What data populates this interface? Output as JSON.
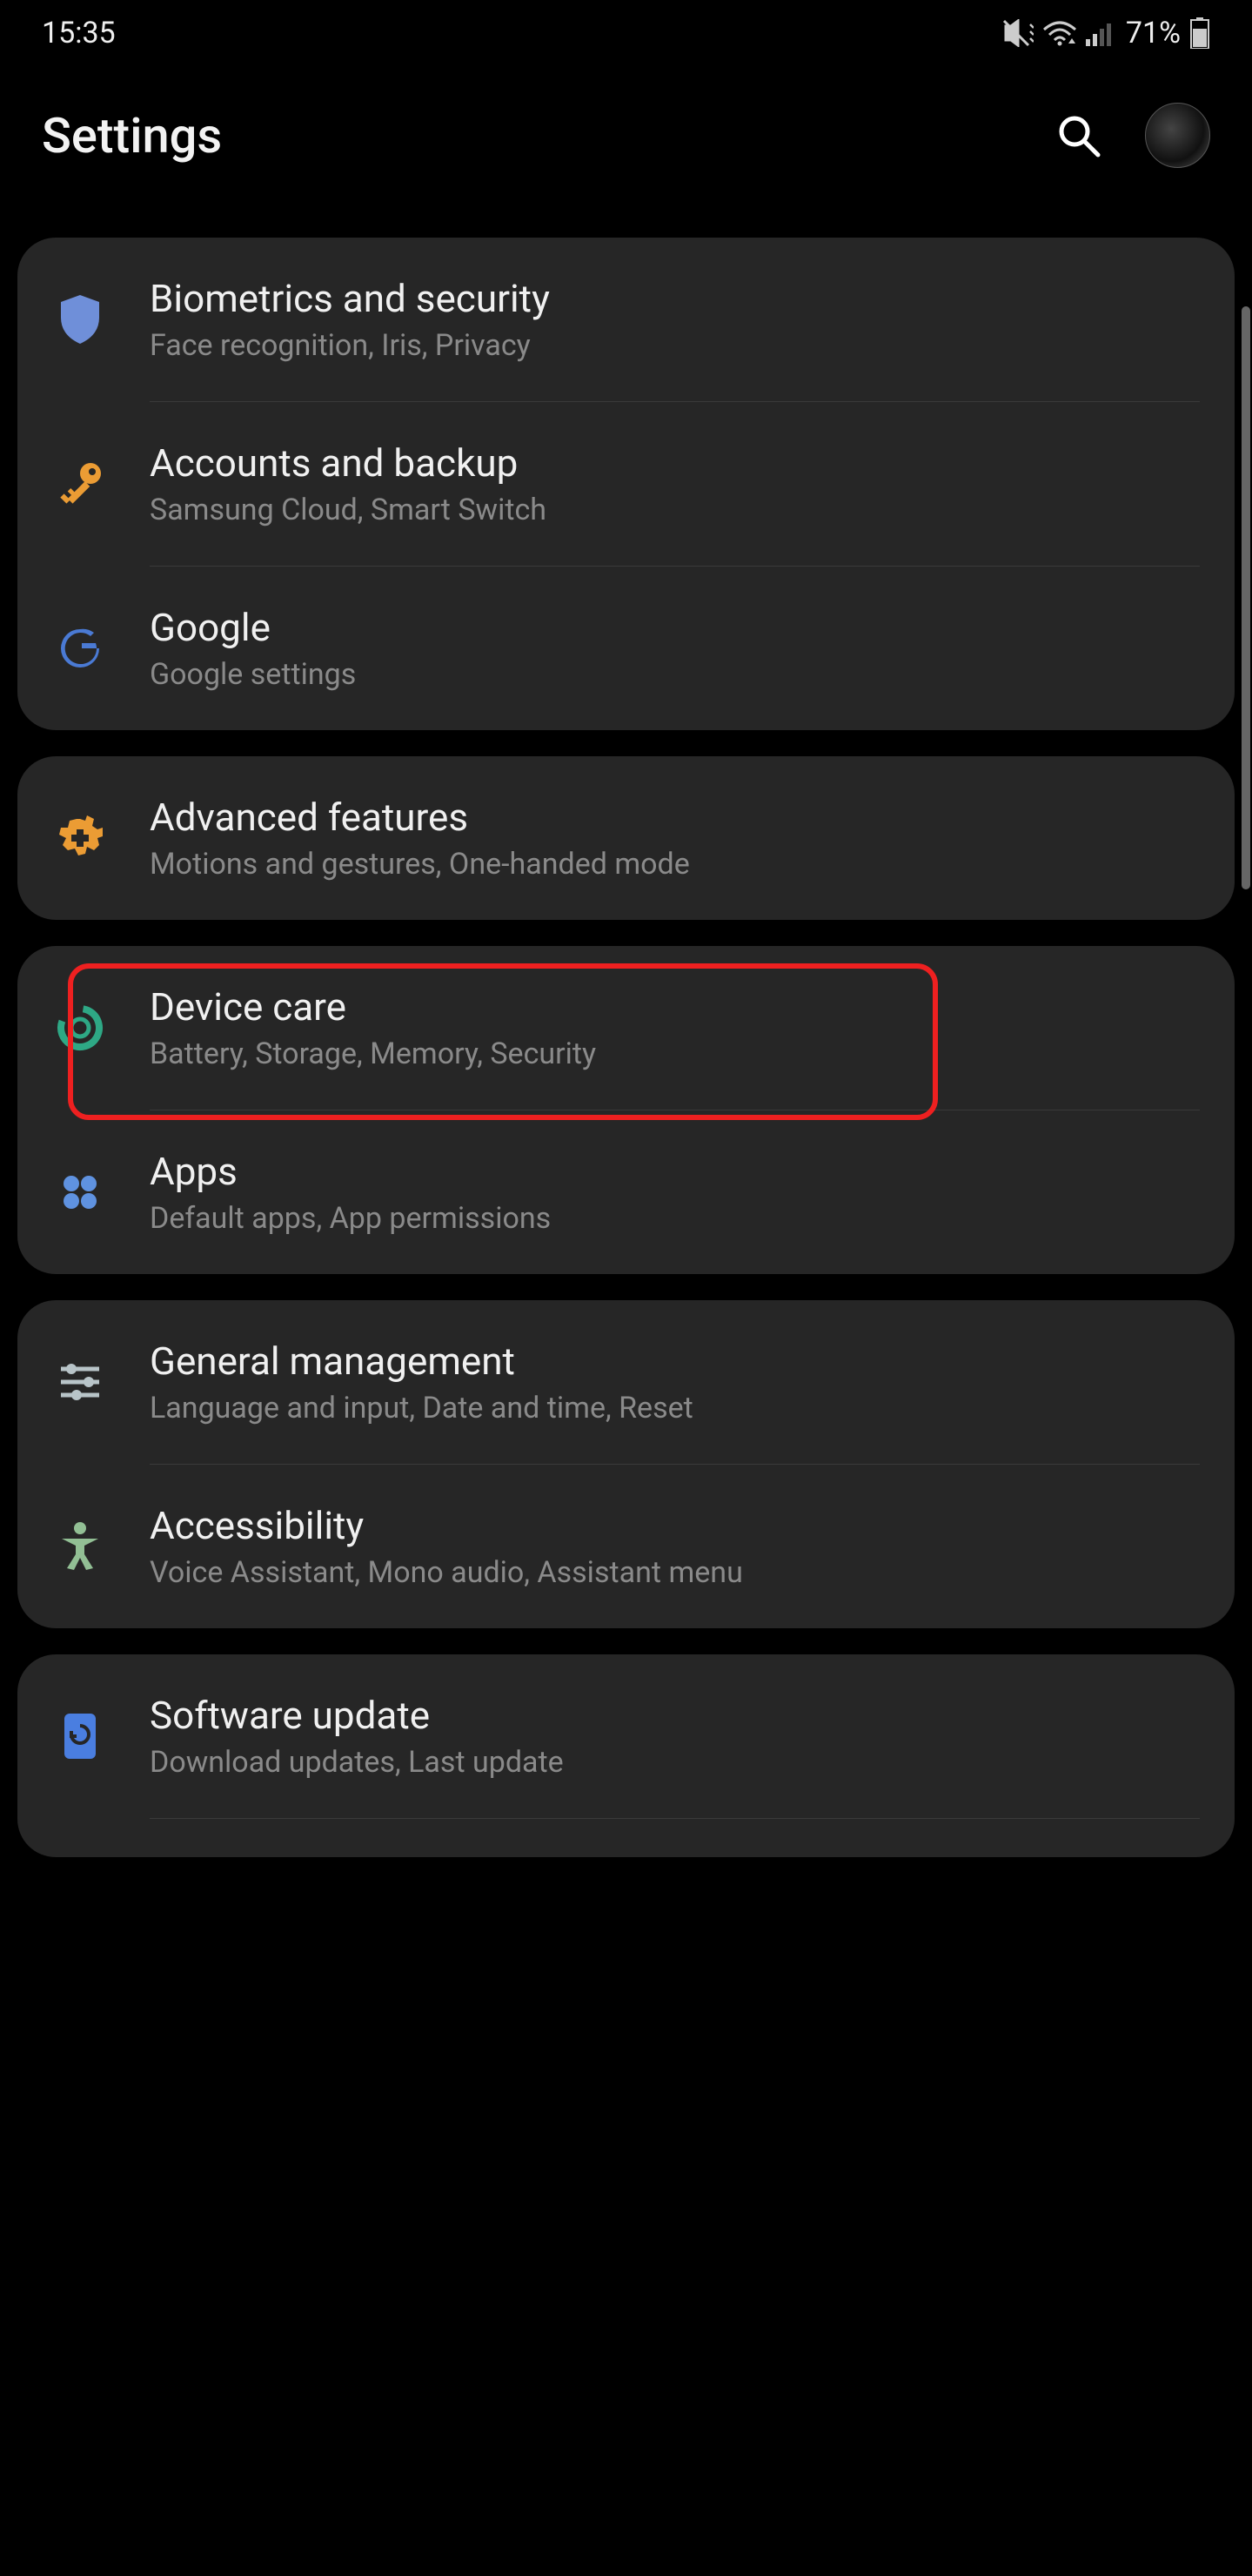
{
  "status": {
    "time": "15:35",
    "battery": "71%"
  },
  "header": {
    "title": "Settings"
  },
  "groups": [
    {
      "items": [
        {
          "id": "biometrics",
          "title": "Biometrics and security",
          "desc": "Face recognition, Iris, Privacy"
        },
        {
          "id": "accounts",
          "title": "Accounts and backup",
          "desc": "Samsung Cloud, Smart Switch"
        },
        {
          "id": "google",
          "title": "Google",
          "desc": "Google settings"
        }
      ]
    },
    {
      "items": [
        {
          "id": "advanced",
          "title": "Advanced features",
          "desc": "Motions and gestures, One-handed mode"
        }
      ]
    },
    {
      "items": [
        {
          "id": "devicecare",
          "title": "Device care",
          "desc": "Battery, Storage, Memory, Security",
          "highlighted": true
        },
        {
          "id": "apps",
          "title": "Apps",
          "desc": "Default apps, App permissions"
        }
      ]
    },
    {
      "items": [
        {
          "id": "general",
          "title": "General management",
          "desc": "Language and input, Date and time, Reset"
        },
        {
          "id": "accessibility",
          "title": "Accessibility",
          "desc": "Voice Assistant, Mono audio, Assistant menu"
        }
      ]
    },
    {
      "items": [
        {
          "id": "software",
          "title": "Software update",
          "desc": "Download updates, Last update"
        }
      ]
    }
  ]
}
